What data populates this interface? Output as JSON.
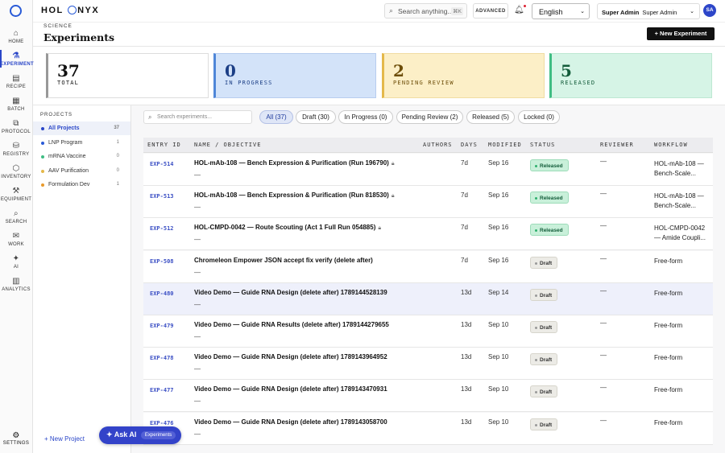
{
  "app": {
    "brand_left": "HOL",
    "brand_right": "NYX"
  },
  "rail": {
    "items": [
      {
        "label": "HOME",
        "icon": "home-icon",
        "glyph": "⌂"
      },
      {
        "label": "EXPERIMENT",
        "icon": "flask-icon",
        "glyph": "⚗"
      },
      {
        "label": "RECIPE",
        "icon": "clipboard-icon",
        "glyph": "▤"
      },
      {
        "label": "BATCH",
        "icon": "batch-icon",
        "glyph": "▦"
      },
      {
        "label": "PROTOCOL",
        "icon": "protocol-icon",
        "glyph": "⧉"
      },
      {
        "label": "REGISTRY",
        "icon": "database-icon",
        "glyph": "⛁"
      },
      {
        "label": "INVENTORY",
        "icon": "box-icon",
        "glyph": "⬡"
      },
      {
        "label": "EQUIPMENT",
        "icon": "wrench-icon",
        "glyph": "⚒"
      },
      {
        "label": "SEARCH",
        "icon": "search-icon",
        "glyph": "⌕"
      },
      {
        "label": "WORK",
        "icon": "inbox-icon",
        "glyph": "✉"
      },
      {
        "label": "AI",
        "icon": "sparkle-icon",
        "glyph": "✦"
      },
      {
        "label": "ANALYTICS",
        "icon": "chart-icon",
        "glyph": "▥"
      }
    ],
    "settings": {
      "label": "SETTINGS",
      "glyph": "⚙"
    }
  },
  "topbar": {
    "search_placeholder": "Search anything...",
    "search_shortcut": "⌘K",
    "advanced_label": "ADVANCED",
    "language": "English",
    "user_role": "Super Admin",
    "user_name": "Super Admin",
    "avatar_initials": "SA"
  },
  "page": {
    "breadcrumb": "SCIENCE",
    "title": "Experiments",
    "new_button": "+  New Experiment"
  },
  "stats": [
    {
      "value": "37",
      "label": "TOTAL"
    },
    {
      "value": "0",
      "label": "IN PROGRESS"
    },
    {
      "value": "2",
      "label": "PENDING REVIEW"
    },
    {
      "value": "5",
      "label": "RELEASED"
    }
  ],
  "projects": {
    "heading": "PROJECTS",
    "items": [
      {
        "name": "All Projects",
        "count": "37",
        "color": "#2a46c8"
      },
      {
        "name": "LNP Program",
        "count": "1",
        "color": "#2a5bd7"
      },
      {
        "name": "mRNA Vaccine",
        "count": "0",
        "color": "#3fbd83"
      },
      {
        "name": "AAV Purification",
        "count": "0",
        "color": "#e4b84a"
      },
      {
        "name": "Formulation Dev",
        "count": "1",
        "color": "#e89a2c"
      }
    ],
    "new_label": "+  New Project"
  },
  "ask_ai": {
    "label": "Ask AI",
    "tag": "Experiments"
  },
  "list": {
    "search_placeholder": "Search experiments...",
    "filters": [
      {
        "label": "All (37)"
      },
      {
        "label": "Draft (30)"
      },
      {
        "label": "In Progress (0)"
      },
      {
        "label": "Pending Review (2)"
      },
      {
        "label": "Released (5)"
      },
      {
        "label": "Locked (0)"
      }
    ],
    "columns": {
      "entry_id": "ENTRY ID",
      "name": "NAME / OBJECTIVE",
      "authors": "AUTHORS",
      "days": "DAYS",
      "modified": "MODIFIED",
      "status": "STATUS",
      "reviewer": "REVIEWER",
      "workflow": "WORKFLOW"
    },
    "rows": [
      {
        "id": "EXP-514",
        "name": "HOL-mAb-108 — Bench Expression & Purification (Run 196790)",
        "locked": true,
        "objective": "—",
        "days": "7d",
        "modified": "Sep 16",
        "status": "Released",
        "reviewer": "—",
        "workflow": "HOL-mAb-108 — Bench-Scale..."
      },
      {
        "id": "EXP-513",
        "name": "HOL-mAb-108 — Bench Expression & Purification (Run 818530)",
        "locked": true,
        "objective": "—",
        "days": "7d",
        "modified": "Sep 16",
        "status": "Released",
        "reviewer": "—",
        "workflow": "HOL-mAb-108 — Bench-Scale..."
      },
      {
        "id": "EXP-512",
        "name": "HOL-CMPD-0042 — Route Scouting (Act 1 Full Run 054885)",
        "locked": true,
        "objective": "—",
        "days": "7d",
        "modified": "Sep 16",
        "status": "Released",
        "reviewer": "—",
        "workflow": "HOL-CMPD-0042 — Amide Coupli..."
      },
      {
        "id": "EXP-508",
        "name": "Chromeleon Empower JSON accept fix verify (delete after)",
        "locked": false,
        "objective": "—",
        "days": "7d",
        "modified": "Sep 16",
        "status": "Draft",
        "reviewer": "—",
        "workflow": "Free-form"
      },
      {
        "id": "EXP-480",
        "name": "Video Demo — Guide RNA Design (delete after) 1789144528139",
        "locked": false,
        "objective": "—",
        "days": "13d",
        "modified": "Sep 14",
        "status": "Draft",
        "reviewer": "—",
        "workflow": "Free-form"
      },
      {
        "id": "EXP-479",
        "name": "Video Demo — Guide RNA Results (delete after) 1789144279655",
        "locked": false,
        "objective": "—",
        "days": "13d",
        "modified": "Sep 10",
        "status": "Draft",
        "reviewer": "—",
        "workflow": "Free-form"
      },
      {
        "id": "EXP-478",
        "name": "Video Demo — Guide RNA Design (delete after) 1789143964952",
        "locked": false,
        "objective": "—",
        "days": "13d",
        "modified": "Sep 10",
        "status": "Draft",
        "reviewer": "—",
        "workflow": "Free-form"
      },
      {
        "id": "EXP-477",
        "name": "Video Demo — Guide RNA Design (delete after) 1789143470931",
        "locked": false,
        "objective": "—",
        "days": "13d",
        "modified": "Sep 10",
        "status": "Draft",
        "reviewer": "—",
        "workflow": "Free-form"
      },
      {
        "id": "EXP-476",
        "name": "Video Demo — Guide RNA Design (delete after) 1789143058700",
        "locked": false,
        "objective": "—",
        "days": "13d",
        "modified": "Sep 10",
        "status": "Draft",
        "reviewer": "—",
        "workflow": "Free-form"
      }
    ]
  }
}
